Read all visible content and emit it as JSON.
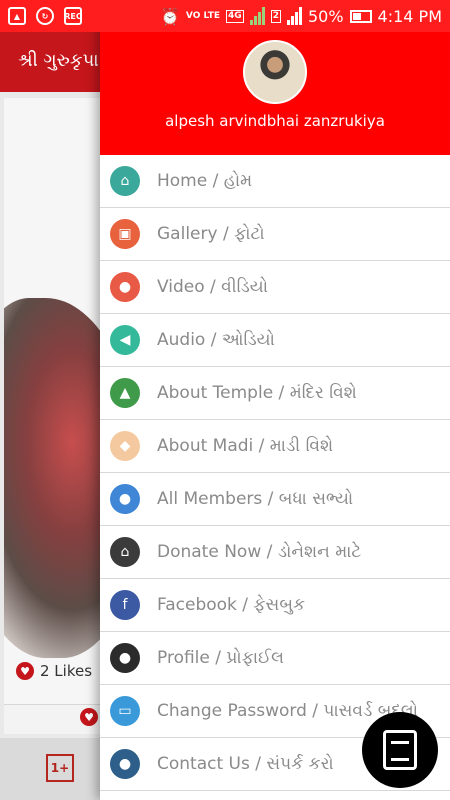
{
  "status_bar": {
    "time": "4:14 PM",
    "battery": "50%",
    "network": "4G",
    "volte": "VO LTE",
    "sim2": "2",
    "left_icons": [
      "gallery-icon",
      "sync-icon",
      "rec-icon"
    ],
    "rec_label": "REC"
  },
  "background_app": {
    "title": "શ્રી ગુરુકૃપા",
    "likes": "2 Likes"
  },
  "drawer": {
    "user_name": "alpesh arvindbhai zanzrukiya",
    "items": [
      {
        "label": "Home / હોમ",
        "icon": "home-icon",
        "color": "#3aa89a",
        "glyph": "⌂"
      },
      {
        "label": "Gallery / ફોટો",
        "icon": "gallery-icon",
        "color": "#e8623e",
        "glyph": "▣"
      },
      {
        "label": "Video / વીડિયો",
        "icon": "video-camera-icon",
        "color": "#e85a45",
        "glyph": "●"
      },
      {
        "label": "Audio / ઓડિયો",
        "icon": "speaker-icon",
        "color": "#35b99b",
        "glyph": "◀"
      },
      {
        "label": "About Temple / મંદિર વિશે",
        "icon": "temple-icon",
        "color": "#3f9a4a",
        "glyph": "▲"
      },
      {
        "label": "About Madi / માડી વિશે",
        "icon": "madi-icon",
        "color": "#f5c9a0",
        "glyph": "◆"
      },
      {
        "label": "All Members / બધા સભ્યો",
        "icon": "members-icon",
        "color": "#3f86d6",
        "glyph": "●"
      },
      {
        "label": "Donate Now / ડોનેશન માટે",
        "icon": "donate-home-icon",
        "color": "#3b3b3b",
        "glyph": "⌂"
      },
      {
        "label": "Facebook / ફેસબુક",
        "icon": "facebook-icon",
        "color": "#3b5aa3",
        "glyph": "f"
      },
      {
        "label": "Profile / પ્રોફાઈલ",
        "icon": "profile-icon",
        "color": "#2b2b2b",
        "glyph": "●"
      },
      {
        "label": "Change Password / પાસવર્ડ બદલો",
        "icon": "password-icon",
        "color": "#3a9ad9",
        "glyph": "▭"
      },
      {
        "label": "Contact Us / સંપર્ક કરો",
        "icon": "location-pin-icon",
        "color": "#2d5f8a",
        "glyph": "●"
      }
    ]
  }
}
